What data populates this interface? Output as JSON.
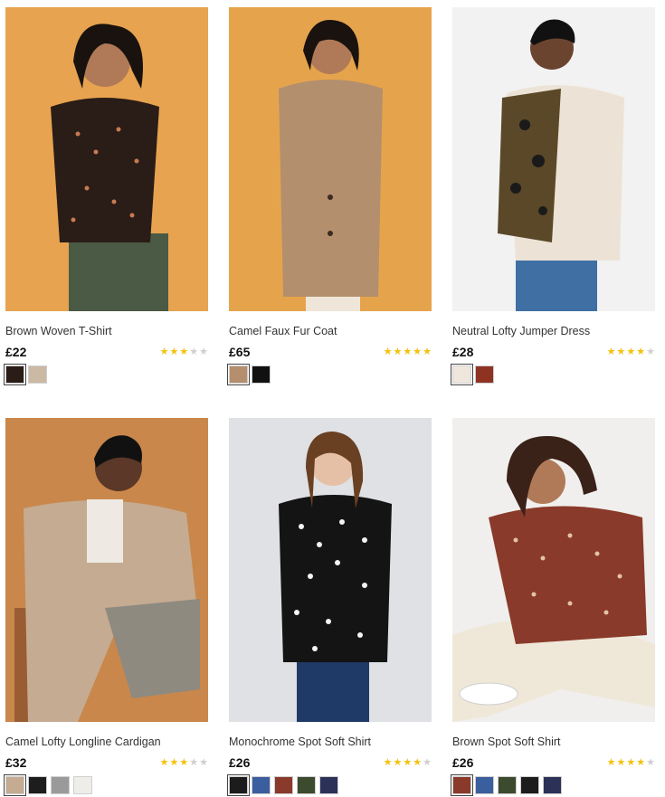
{
  "products": [
    {
      "name": "Brown Woven T-Shirt",
      "price": "£22",
      "rating": 3,
      "image_desc": "brown-woven-tshirt-photo",
      "bg": "#e7a34f",
      "swatches": [
        "#2a1c17",
        "#cbb9a3"
      ]
    },
    {
      "name": "Camel Faux Fur Coat",
      "price": "£65",
      "rating": 5,
      "image_desc": "camel-faux-fur-coat-photo",
      "bg": "#e5a44c",
      "swatches": [
        "#b58f6d",
        "#111111"
      ]
    },
    {
      "name": "Neutral Lofty Jumper Dress",
      "price": "£28",
      "rating": 4,
      "image_desc": "neutral-lofty-jumper-dress-photo",
      "bg": "#f2f2f2",
      "swatches": [
        "#efe7dc",
        "#8e3322"
      ]
    },
    {
      "name": "Camel Lofty Longline Cardigan",
      "price": "£32",
      "rating": 3,
      "image_desc": "camel-lofty-longline-cardigan-photo",
      "bg": "#c9874b",
      "swatches": [
        "#c4ab92",
        "#1d1d1d",
        "#9a9a9a",
        "#efede8"
      ]
    },
    {
      "name": "Monochrome Spot Soft Shirt",
      "price": "£26",
      "rating": 4,
      "image_desc": "monochrome-spot-soft-shirt-photo",
      "bg": "#dfe1e4",
      "swatches": [
        "#1c1c1c",
        "#3b5e9e",
        "#8a3a2a",
        "#3c4a2e",
        "#2c3158"
      ]
    },
    {
      "name": "Brown Spot Soft Shirt",
      "price": "£26",
      "rating": 4,
      "image_desc": "brown-spot-soft-shirt-photo",
      "bg": "#f0efed",
      "swatches": [
        "#8a3a2a",
        "#3b5e9e",
        "#3c4a2e",
        "#1c1c1c",
        "#2c3158"
      ]
    }
  ]
}
